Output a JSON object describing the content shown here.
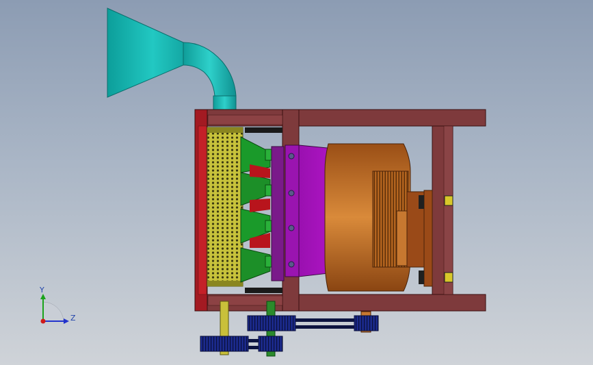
{
  "viewport": {
    "background_top": "#8c9cb3",
    "background_bottom": "#cfd3d8"
  },
  "model": {
    "parts": [
      "hopper-funnel",
      "inlet-pipe-elbow",
      "main-frame",
      "perforated-screen-drum",
      "green-cutter-blades",
      "magenta-guard-cover",
      "electric-motor",
      "motor-base-plate",
      "belt-drive-pulleys",
      "shafts"
    ],
    "colors": {
      "hopper": "#1fb7b3",
      "frame": "#7a3a3a",
      "screen": "#c8c23a",
      "blades": "#1a9a2a",
      "guard": "#b81ad0",
      "motor": "#c5722a",
      "pulleys": "#1a2a8a",
      "shaft_left": "#c9c03a",
      "shaft_right": "#2b8a2b"
    }
  },
  "triad": {
    "y_label": "Y",
    "z_label": "Z",
    "y_color": "#1aa31a",
    "z_color": "#2233cc",
    "origin_color": "#d01a1a"
  }
}
